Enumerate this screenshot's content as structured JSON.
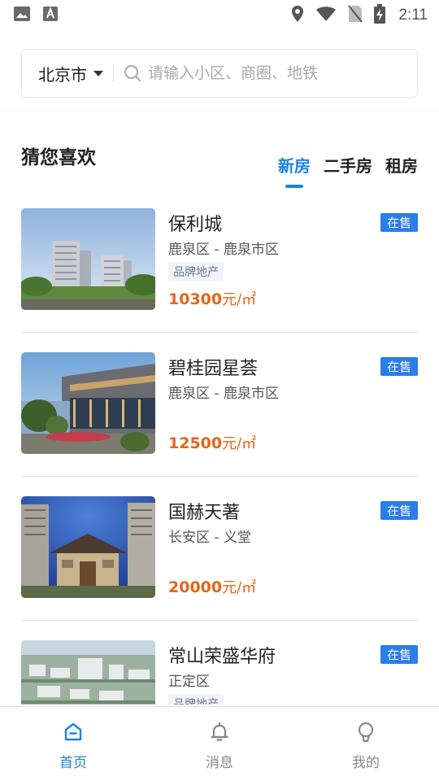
{
  "status_bar": {
    "time": "2:11",
    "icons": [
      "gallery-icon",
      "text-recognition-icon",
      "location-icon",
      "wifi-icon",
      "no-sim-icon",
      "battery-charging-icon"
    ]
  },
  "search": {
    "city": "北京市",
    "placeholder": "请输入小区、商圈、地铁"
  },
  "section": {
    "title": "猜您喜欢",
    "tabs": [
      {
        "label": "新房",
        "active": true
      },
      {
        "label": "二手房",
        "active": false
      },
      {
        "label": "租房",
        "active": false
      }
    ]
  },
  "listings": [
    {
      "name": "保利城",
      "area": "鹿泉区 - 鹿泉市区",
      "tag": "品牌地产",
      "price": "10300",
      "unit": "元/㎡",
      "status": "在售",
      "image": "high-rise-towers"
    },
    {
      "name": "碧桂园星荟",
      "area": "鹿泉区 - 鹿泉市区",
      "tag": "",
      "price": "12500",
      "unit": "元/㎡",
      "status": "在售",
      "image": "sales-center-building"
    },
    {
      "name": "国赫天著",
      "area": "长安区 - 义堂",
      "tag": "",
      "price": "20000",
      "unit": "元/㎡",
      "status": "在售",
      "image": "residential-gate-blue-sky"
    },
    {
      "name": "常山荣盛华府",
      "area": "正定区",
      "tag": "品牌地产",
      "price": "",
      "unit": "",
      "status": "在售",
      "image": "aerial-residential-district"
    }
  ],
  "bottom_nav": [
    {
      "label": "首页",
      "icon": "home-icon",
      "active": true
    },
    {
      "label": "消息",
      "icon": "bell-icon",
      "active": false
    },
    {
      "label": "我的",
      "icon": "profile-icon",
      "active": false
    }
  ],
  "colors": {
    "accent": "#1a82e6",
    "price": "#e8641a",
    "badge": "#2b7de9"
  }
}
